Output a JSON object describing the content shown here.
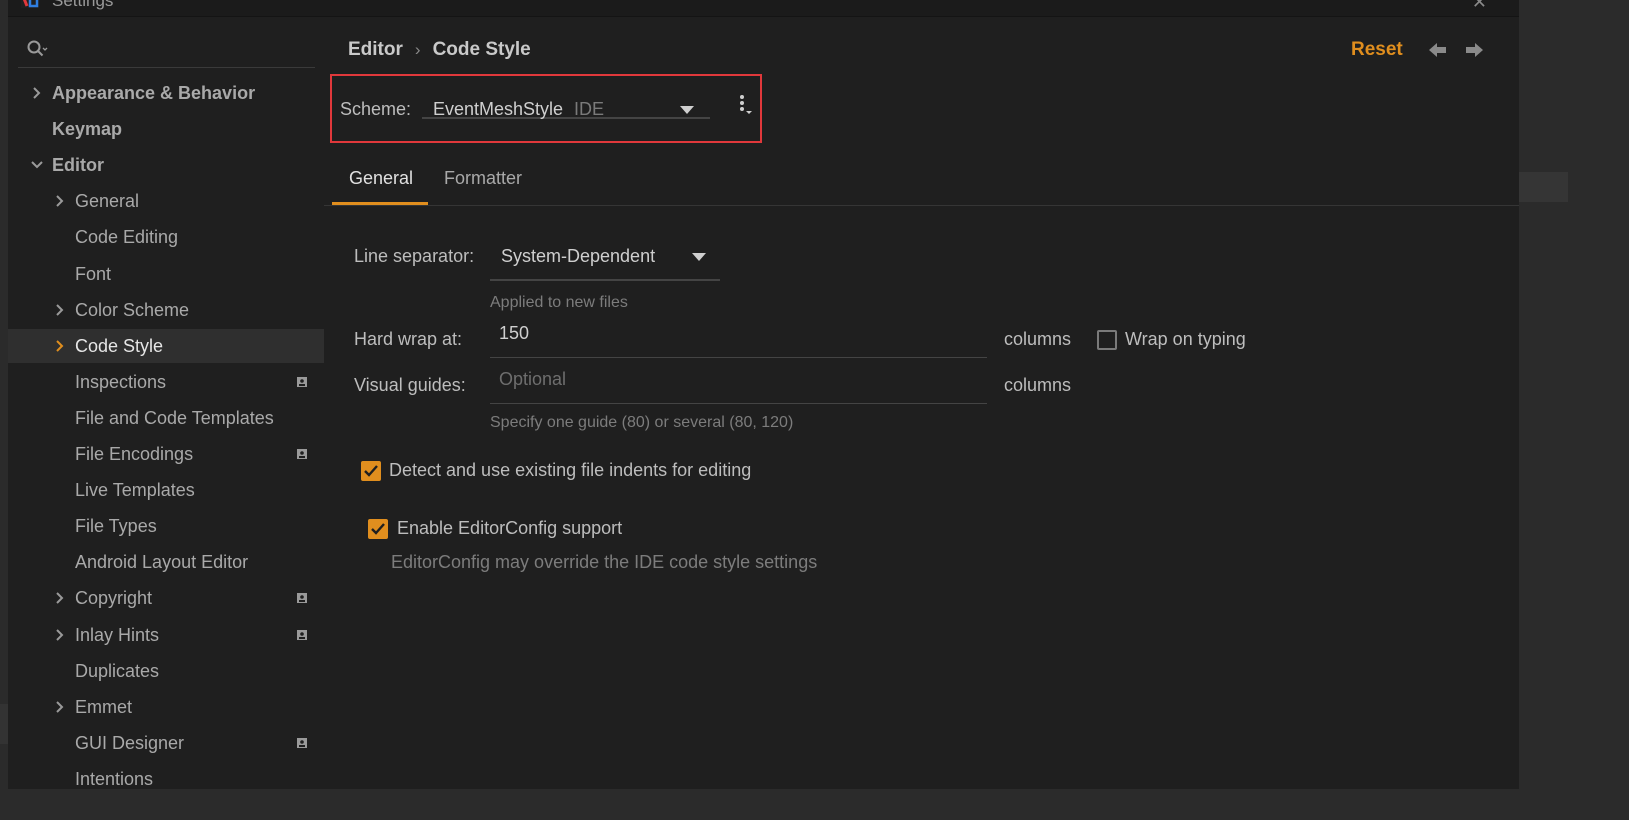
{
  "window": {
    "title": "Settings"
  },
  "sidebar": {
    "search_placeholder": "",
    "items": [
      {
        "label": "Appearance & Behavior",
        "level": 0,
        "expandable": true,
        "expanded": false,
        "badge": false,
        "selected": false
      },
      {
        "label": "Keymap",
        "level": 0,
        "expandable": false,
        "expanded": false,
        "badge": false,
        "selected": false
      },
      {
        "label": "Editor",
        "level": 0,
        "expandable": true,
        "expanded": true,
        "badge": false,
        "selected": false
      },
      {
        "label": "General",
        "level": 1,
        "expandable": true,
        "expanded": false,
        "badge": false,
        "selected": false
      },
      {
        "label": "Code Editing",
        "level": 1,
        "expandable": false,
        "expanded": false,
        "badge": false,
        "selected": false
      },
      {
        "label": "Font",
        "level": 1,
        "expandable": false,
        "expanded": false,
        "badge": false,
        "selected": false
      },
      {
        "label": "Color Scheme",
        "level": 1,
        "expandable": true,
        "expanded": false,
        "badge": false,
        "selected": false
      },
      {
        "label": "Code Style",
        "level": 1,
        "expandable": true,
        "expanded": false,
        "badge": false,
        "selected": true
      },
      {
        "label": "Inspections",
        "level": 1,
        "expandable": false,
        "expanded": false,
        "badge": true,
        "selected": false
      },
      {
        "label": "File and Code Templates",
        "level": 1,
        "expandable": false,
        "expanded": false,
        "badge": false,
        "selected": false
      },
      {
        "label": "File Encodings",
        "level": 1,
        "expandable": false,
        "expanded": false,
        "badge": true,
        "selected": false
      },
      {
        "label": "Live Templates",
        "level": 1,
        "expandable": false,
        "expanded": false,
        "badge": false,
        "selected": false
      },
      {
        "label": "File Types",
        "level": 1,
        "expandable": false,
        "expanded": false,
        "badge": false,
        "selected": false
      },
      {
        "label": "Android Layout Editor",
        "level": 1,
        "expandable": false,
        "expanded": false,
        "badge": false,
        "selected": false
      },
      {
        "label": "Copyright",
        "level": 1,
        "expandable": true,
        "expanded": false,
        "badge": true,
        "selected": false
      },
      {
        "label": "Inlay Hints",
        "level": 1,
        "expandable": true,
        "expanded": false,
        "badge": true,
        "selected": false
      },
      {
        "label": "Duplicates",
        "level": 1,
        "expandable": false,
        "expanded": false,
        "badge": false,
        "selected": false
      },
      {
        "label": "Emmet",
        "level": 1,
        "expandable": true,
        "expanded": false,
        "badge": false,
        "selected": false
      },
      {
        "label": "GUI Designer",
        "level": 1,
        "expandable": false,
        "expanded": false,
        "badge": true,
        "selected": false
      },
      {
        "label": "Intentions",
        "level": 1,
        "expandable": false,
        "expanded": false,
        "badge": false,
        "selected": false
      }
    ]
  },
  "breadcrumb": {
    "parent": "Editor",
    "separator": "›",
    "current": "Code Style"
  },
  "header": {
    "reset_label": "Reset"
  },
  "scheme": {
    "label": "Scheme:",
    "name": "EventMeshStyle",
    "type": "IDE"
  },
  "tabs": [
    {
      "label": "General",
      "active": true
    },
    {
      "label": "Formatter",
      "active": false
    }
  ],
  "general": {
    "line_separator_label": "Line separator:",
    "line_separator_value": "System-Dependent",
    "line_separator_hint": "Applied to new files",
    "hard_wrap_label": "Hard wrap at:",
    "hard_wrap_value": "150",
    "hard_wrap_unit": "columns",
    "wrap_on_typing_label": "Wrap on typing",
    "wrap_on_typing_checked": false,
    "visual_guides_label": "Visual guides:",
    "visual_guides_placeholder": "Optional",
    "visual_guides_unit": "columns",
    "visual_guides_hint": "Specify one guide (80) or several (80, 120)",
    "detect_indents_label": "Detect and use existing file indents for editing",
    "detect_indents_checked": true,
    "editorconfig_label": "Enable EditorConfig support",
    "editorconfig_checked": true,
    "editorconfig_hint": "EditorConfig may override the IDE code style settings"
  },
  "colors": {
    "accent": "#e08e1e",
    "highlight_border": "#e0383b",
    "background": "#1f1f1f"
  }
}
